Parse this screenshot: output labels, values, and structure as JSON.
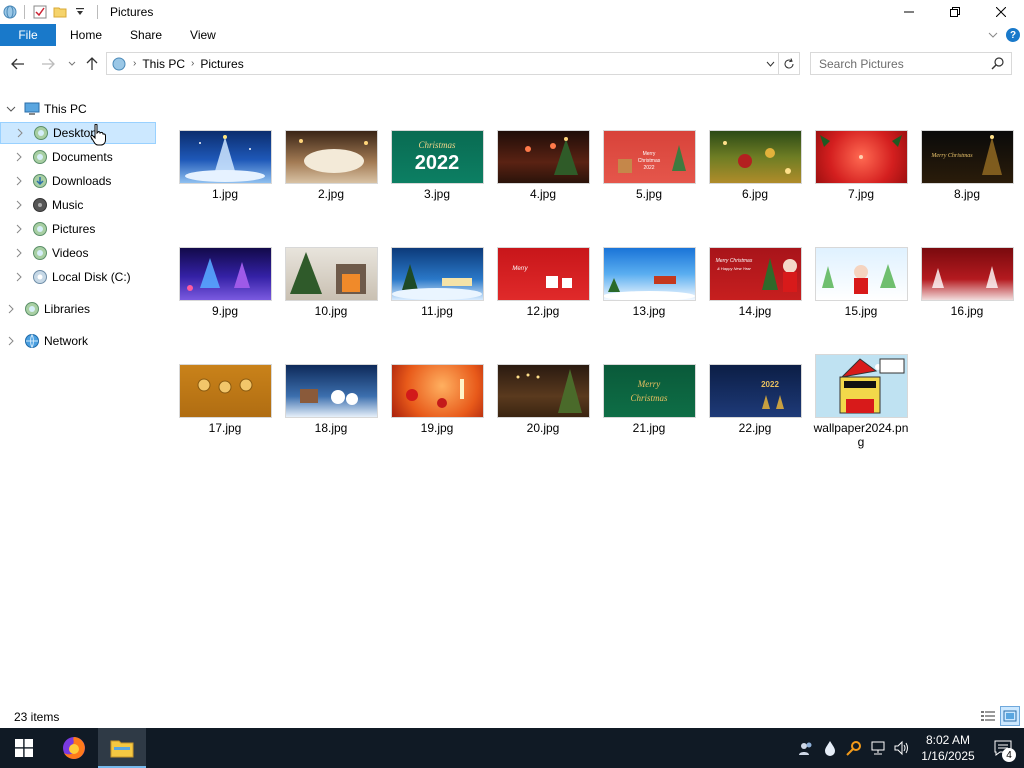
{
  "window": {
    "title": "Pictures",
    "minimize_icon": "minimize-icon",
    "maximize_icon": "restore-icon",
    "close_icon": "close-icon"
  },
  "ribbon": {
    "tabs": [
      {
        "label": "File"
      },
      {
        "label": "Home"
      },
      {
        "label": "Share"
      },
      {
        "label": "View"
      }
    ],
    "accent": "#1979ca"
  },
  "address": {
    "crumbs": [
      {
        "label": "This PC"
      },
      {
        "label": "Pictures"
      }
    ]
  },
  "search": {
    "placeholder": "Search Pictures"
  },
  "sidebar": {
    "items": [
      {
        "label": "This PC"
      },
      {
        "label": "Desktop"
      },
      {
        "label": "Documents"
      },
      {
        "label": "Downloads"
      },
      {
        "label": "Music"
      },
      {
        "label": "Pictures"
      },
      {
        "label": "Videos"
      },
      {
        "label": "Local Disk (C:)"
      },
      {
        "label": "Libraries"
      },
      {
        "label": "Network"
      }
    ],
    "selected": "Desktop"
  },
  "files": [
    {
      "name": "1.jpg"
    },
    {
      "name": "2.jpg"
    },
    {
      "name": "3.jpg",
      "thumb_text": "Christmas 2022"
    },
    {
      "name": "4.jpg"
    },
    {
      "name": "5.jpg",
      "thumb_text": "Merry Christmas 2022"
    },
    {
      "name": "6.jpg"
    },
    {
      "name": "7.jpg"
    },
    {
      "name": "8.jpg",
      "thumb_text": "Merry Christmas"
    },
    {
      "name": "9.jpg"
    },
    {
      "name": "10.jpg"
    },
    {
      "name": "11.jpg"
    },
    {
      "name": "12.jpg"
    },
    {
      "name": "13.jpg"
    },
    {
      "name": "14.jpg",
      "thumb_text": "Merry Christmas & Happy New Year"
    },
    {
      "name": "15.jpg"
    },
    {
      "name": "16.jpg"
    },
    {
      "name": "17.jpg"
    },
    {
      "name": "18.jpg"
    },
    {
      "name": "19.jpg"
    },
    {
      "name": "20.jpg"
    },
    {
      "name": "21.jpg",
      "thumb_text": "Merry Christmas"
    },
    {
      "name": "22.jpg",
      "thumb_text": "2022"
    },
    {
      "name": "wallpaper2024.png"
    }
  ],
  "status": {
    "item_count": "23 items"
  },
  "taskbar": {
    "time": "8:02 AM",
    "date": "1/16/2025",
    "notification_count": "4"
  }
}
